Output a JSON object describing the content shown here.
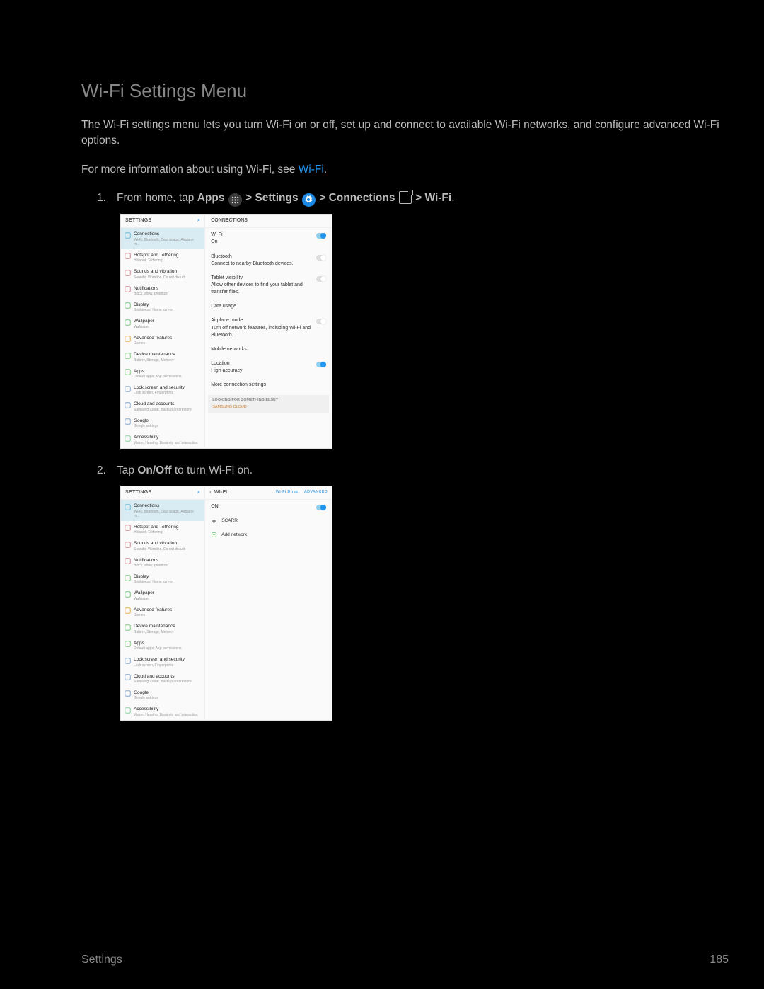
{
  "title": "Wi-Fi Settings Menu",
  "intro": "The Wi-Fi settings menu lets you turn Wi-Fi on or off, set up and connect to available Wi-Fi networks, and configure advanced Wi-Fi options.",
  "moreinfo_pre": "For more information about using Wi-Fi, see ",
  "moreinfo_link": "Wi-Fi",
  "step1": {
    "pre": "From home, tap ",
    "apps": "Apps",
    "gt1": " > ",
    "settings": "Settings",
    "gt2": " > ",
    "connections": "Connections",
    "gt3": " > ",
    "wifi": "Wi-Fi",
    "dot": "."
  },
  "step2_pre": "Tap ",
  "step2_b": "On/Off",
  "step2_post": " to turn Wi-Fi on.",
  "sidebar_hdr": "SETTINGS",
  "sidebar": [
    {
      "t": "Connections",
      "s": "Wi-Fi, Bluetooth, Data usage, Airplane m...",
      "c": "#6fb8d6"
    },
    {
      "t": "Hotspot and Tethering",
      "s": "Hotspot, Tethering",
      "c": "#d08890"
    },
    {
      "t": "Sounds and vibration",
      "s": "Sounds, Vibration, Do not disturb",
      "c": "#d08890"
    },
    {
      "t": "Notifications",
      "s": "Block, allow, prioritize",
      "c": "#d08890"
    },
    {
      "t": "Display",
      "s": "Brightness, Home screen",
      "c": "#7ec77e"
    },
    {
      "t": "Wallpaper",
      "s": "Wallpaper",
      "c": "#7ec77e"
    },
    {
      "t": "Advanced features",
      "s": "Games",
      "c": "#e6b050"
    },
    {
      "t": "Device maintenance",
      "s": "Battery, Storage, Memory",
      "c": "#7ec77e"
    },
    {
      "t": "Apps",
      "s": "Default apps, App permissions",
      "c": "#7ec77e"
    },
    {
      "t": "Lock screen and security",
      "s": "Lock screen, Fingerprints",
      "c": "#8aa8d0"
    },
    {
      "t": "Cloud and accounts",
      "s": "Samsung Cloud, Backup and restore",
      "c": "#8aa8d0"
    },
    {
      "t": "Google",
      "s": "Google settings",
      "c": "#8aa8d0"
    },
    {
      "t": "Accessibility",
      "s": "Vision, Hearing, Dexterity and interaction",
      "c": "#8dd0a0"
    }
  ],
  "right1_hdr": "CONNECTIONS",
  "right1": [
    {
      "t": "Wi-Fi",
      "s": "On",
      "son": true,
      "tg": "on"
    },
    {
      "t": "Bluetooth",
      "s": "Connect to nearby Bluetooth devices.",
      "tg": "off"
    },
    {
      "t": "Tablet visibility",
      "s": "Allow other devices to find your tablet and transfer files.",
      "tg": "off"
    },
    {
      "t": "Data usage",
      "s": ""
    },
    {
      "t": "Airplane mode",
      "s": "Turn off network features, including Wi-Fi and Bluetooth.",
      "tg": "off"
    },
    {
      "t": "Mobile networks",
      "s": ""
    },
    {
      "t": "Location",
      "s": "High accuracy",
      "shi": true,
      "tg": "on"
    },
    {
      "t": "More connection settings",
      "s": ""
    }
  ],
  "lookbox_h": "LOOKING FOR SOMETHING ELSE?",
  "lookbox_l": "SAMSUNG CLOUD",
  "right2_hdr": "WI-FI",
  "right2_adv1": "Wi-Fi Direct",
  "right2_adv2": "ADVANCED",
  "right2_on": "ON",
  "net1": "SCARR",
  "net2": "Add network",
  "footer_l": "Settings",
  "footer_r": "185"
}
